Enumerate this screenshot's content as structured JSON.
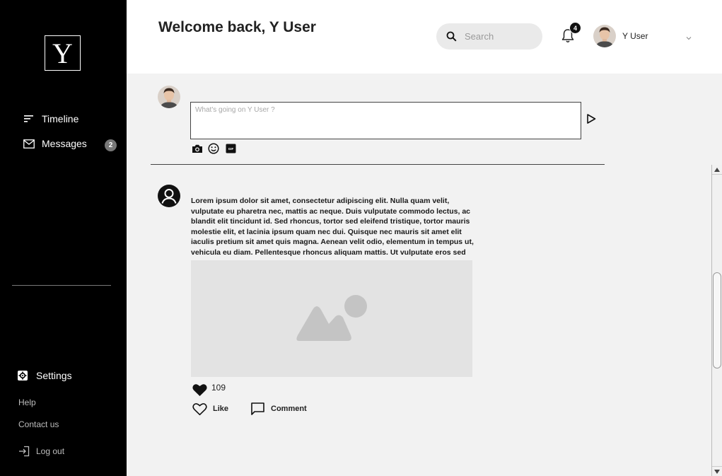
{
  "sidebar": {
    "logo": "Y",
    "nav": [
      {
        "label": "Timeline",
        "icon": "sort-lines-icon"
      },
      {
        "label": "Messages",
        "icon": "mail-icon",
        "badge": "2"
      }
    ],
    "settings_label": "Settings",
    "help_label": "Help",
    "contact_label": "Contact us",
    "logout_label": "Log out"
  },
  "header": {
    "welcome": "Welcome back, Y User",
    "search_placeholder": "Search",
    "notification_count": "4",
    "user_name": "Y User"
  },
  "composer": {
    "placeholder": "What's going on Y User ?",
    "tools": [
      "camera-icon",
      "emoji-icon",
      "gif-icon"
    ]
  },
  "post": {
    "text": "Lorem ipsum dolor sit amet, consectetur adipiscing elit. Nulla quam velit, vulputate eu pharetra nec, mattis ac neque. Duis vulputate commodo lectus, ac blandit elit tincidunt id. Sed rhoncus, tortor sed eleifend tristique, tortor mauris molestie elit, et lacinia ipsum quam nec dui. Quisque nec mauris sit amet elit iaculis pretium sit amet quis magna. Aenean velit odio, elementum in tempus ut, vehicula eu diam. Pellentesque rhoncus aliquam mattis. Ut vulputate eros sed felis sodales nec vulputate justo hendrerit.",
    "likes": "109",
    "like_label": "Like",
    "comment_label": "Comment"
  },
  "colors": {
    "sidebar_bg": "#000000",
    "page_bg": "#f2f2f2",
    "header_bg": "#ffffff",
    "image_placeholder": "#e3e3e3",
    "message_badge": "#777777"
  }
}
